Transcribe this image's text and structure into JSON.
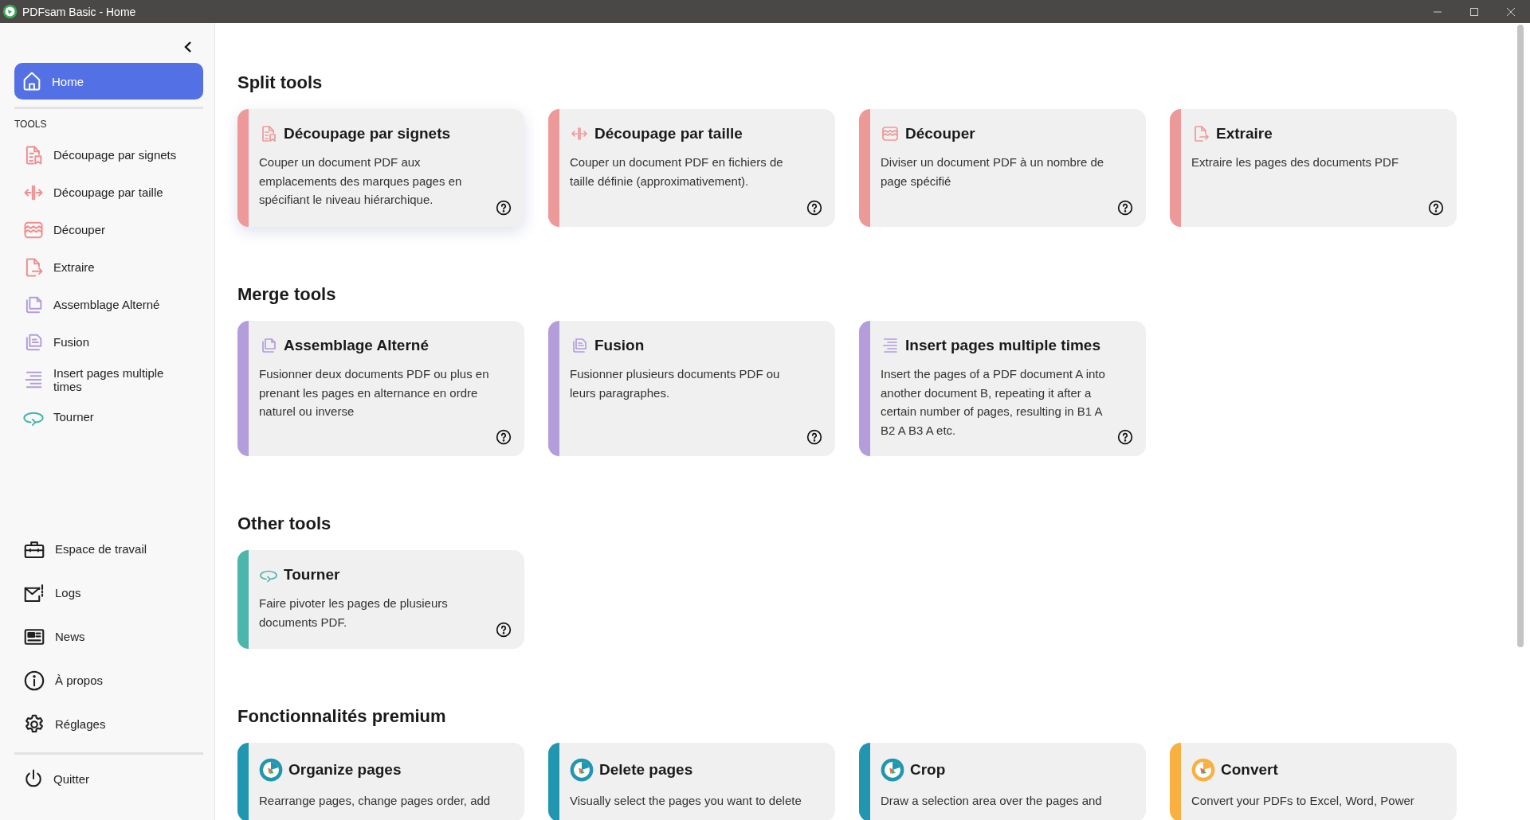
{
  "window": {
    "title": "PDFsam Basic - Home"
  },
  "sidebar": {
    "nav": [
      {
        "label": "Home",
        "kind": "home",
        "selected": true
      }
    ],
    "tools_heading": "TOOLS",
    "tools": [
      {
        "label": "Découpage par signets",
        "kind": "bookmarks",
        "selected": false
      },
      {
        "label": "Découpage par taille",
        "kind": "size",
        "selected": false
      },
      {
        "label": "Découper",
        "kind": "split",
        "selected": false
      },
      {
        "label": "Extraire",
        "kind": "extract",
        "selected": false
      },
      {
        "label": "Assemblage Alterné",
        "kind": "alternate",
        "selected": false
      },
      {
        "label": "Fusion",
        "kind": "merge",
        "selected": false
      },
      {
        "label": "Insert pages multiple times",
        "kind": "insert",
        "selected": false
      },
      {
        "label": "Tourner",
        "kind": "rotate",
        "selected": false
      }
    ],
    "footer": [
      {
        "label": "Espace de travail",
        "kind": "workspace",
        "selected": false
      },
      {
        "label": "Logs",
        "kind": "logs",
        "selected": false
      },
      {
        "label": "News",
        "kind": "news",
        "selected": false
      },
      {
        "label": "À propos",
        "kind": "about",
        "selected": false
      },
      {
        "label": "Réglages",
        "kind": "settings",
        "selected": false
      }
    ],
    "quit": {
      "label": "Quitter",
      "kind": "quit"
    }
  },
  "sections": [
    {
      "title": "Split tools",
      "cards": [
        {
          "kind": "bookmarks",
          "title": "Découpage par signets",
          "description": "Couper un document PDF aux emplacements des marques pages en spécifiant le niveau hiérarchique.",
          "color": "#ee9999",
          "hovered": true
        },
        {
          "kind": "size",
          "title": "Découpage par taille",
          "description": "Couper un document PDF en fichiers de taille définie (approximativement).",
          "color": "#ee9999",
          "hovered": false
        },
        {
          "kind": "split",
          "title": "Découper",
          "description": "Diviser un document PDF à un nombre de page spécifié",
          "color": "#ee9999",
          "hovered": false
        },
        {
          "kind": "extract",
          "title": "Extraire",
          "description": "Extraire les pages des documents PDF",
          "color": "#ee9999",
          "hovered": false
        }
      ]
    },
    {
      "title": "Merge tools",
      "cards": [
        {
          "kind": "alternate",
          "title": "Assemblage Alterné",
          "description": "Fusionner deux documents PDF ou plus en prenant les pages en alternance en ordre naturel ou inverse",
          "color": "#b39ddb",
          "hovered": false
        },
        {
          "kind": "merge",
          "title": "Fusion",
          "description": "Fusionner plusieurs documents PDF ou leurs paragraphes.",
          "color": "#b39ddb",
          "hovered": false
        },
        {
          "kind": "insert",
          "title": "Insert pages multiple times",
          "description": "Insert the pages of a PDF document A into another document B, repeating it after a certain number of pages, resulting in B1 A B2 A B3 A etc.",
          "color": "#b39ddb",
          "hovered": false
        }
      ]
    },
    {
      "title": "Other tools",
      "cards": [
        {
          "kind": "rotate",
          "title": "Tourner",
          "description": "Faire pivoter les pages de plusieurs documents PDF.",
          "color": "#4db6ac",
          "hovered": false
        }
      ]
    },
    {
      "title": "Fonctionnalités premium",
      "cards": [
        {
          "kind": "premium",
          "title": "Organize pages",
          "description": "Rearrange pages, change pages order, add",
          "color": "#2196b0",
          "hovered": false
        },
        {
          "kind": "premium",
          "title": "Delete pages",
          "description": "Visually select the pages you want to delete",
          "color": "#2196b0",
          "hovered": false
        },
        {
          "kind": "premium",
          "title": "Crop",
          "description": "Draw a selection area over the pages and",
          "color": "#2196b0",
          "hovered": false
        },
        {
          "kind": "premium",
          "title": "Convert",
          "description": "Convert your PDFs to Excel, Word, Power",
          "color": "#f9b040",
          "hovered": false
        }
      ]
    }
  ]
}
